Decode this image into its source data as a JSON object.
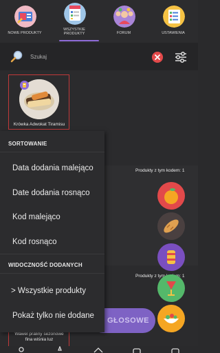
{
  "tabs": {
    "new_products": "Nowe produkty",
    "all_products": "Wszystkie produkty",
    "forum": "Forum",
    "settings": "Ustawienia"
  },
  "search": {
    "placeholder": "Szukaj"
  },
  "products": [
    {
      "name": "Krówka Adwokat Tiramisu"
    },
    {
      "name": "Wawel praliny sezonowe\nfina wiśnia luz"
    }
  ],
  "background": {
    "code_count_1": "Produkty z tym kodem: 1",
    "code_count_2": "Produkty z tym kodem: 1",
    "vote_button": "GŁOSOWE"
  },
  "menu": {
    "sort_title": "SORTOWANIE",
    "sort_items": [
      "Data dodania malejąco",
      "Date dodania rosnąco",
      "Kod malejąco",
      "Kod rosnąco"
    ],
    "visibility_title": "WIDOCZNOŚĆ DODANYCH",
    "visibility_items": [
      "> Wszystkie produkty",
      "Pokaż tylko nie dodane"
    ]
  },
  "colors": {
    "accent": "#8e6bd8",
    "tile_border": "#c23a3a",
    "clear": "#e2494a",
    "background": "#2b2b2d"
  },
  "icons": {
    "new_products": "megaphone-icon",
    "all_products": "document-list-icon",
    "forum": "people-icon",
    "settings": "checklist-icon",
    "search": "magnifier-icon",
    "clear": "close-circle-icon",
    "filter": "sliders-icon"
  }
}
